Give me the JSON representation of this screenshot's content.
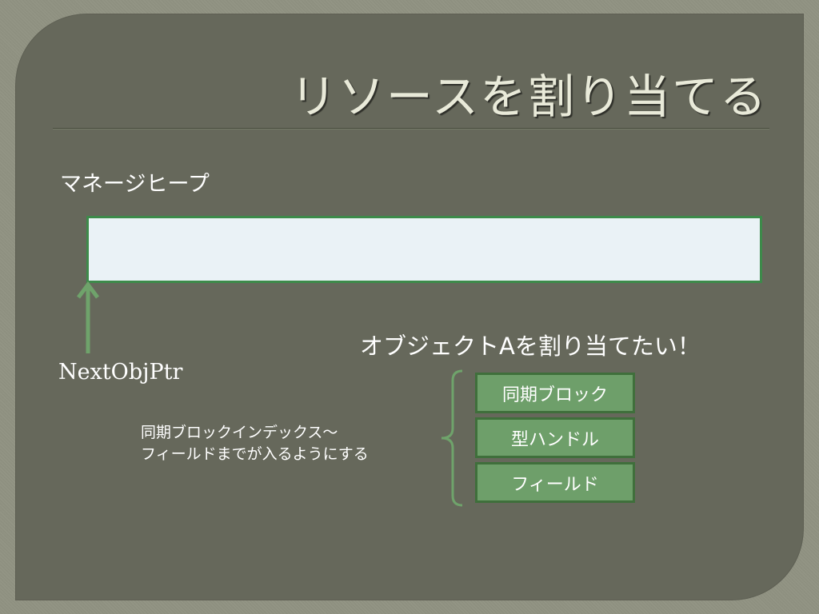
{
  "slide": {
    "title": "リソースを割り当てる"
  },
  "heap": {
    "label": "マネージヒープ"
  },
  "pointer": {
    "label": "NextObjPtr"
  },
  "allocation": {
    "label": "オブジェクトAを割り当てたい！",
    "note_lines": [
      "同期ブロックインデックス～",
      "フィールドまでが入るようにする"
    ],
    "blocks": [
      {
        "label": "同期ブロック"
      },
      {
        "label": "型ハンドル"
      },
      {
        "label": "フィールド"
      }
    ]
  },
  "colors": {
    "background": "#66685b",
    "heap_fill": "#eaf2f6",
    "heap_border": "#3d8a4a",
    "block_fill": "#6e9f6a",
    "arrow": "#6fa36b"
  }
}
